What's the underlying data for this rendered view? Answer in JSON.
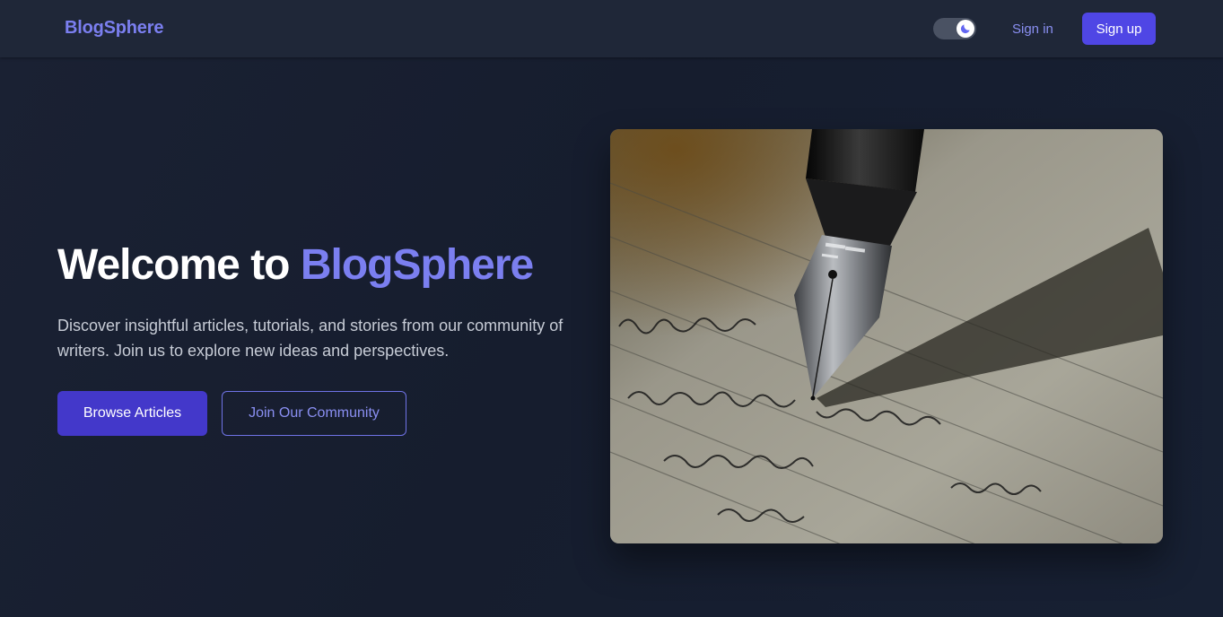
{
  "header": {
    "brand": "BlogSphere",
    "sign_in_label": "Sign in",
    "sign_up_label": "Sign up",
    "theme_toggle_icon": "moon-icon"
  },
  "hero": {
    "title_prefix": "Welcome to ",
    "title_highlight": "BlogSphere",
    "description": "Discover insightful articles, tutorials, and stories from our community of writers. Join us to explore new ideas and perspectives.",
    "primary_button": "Browse Articles",
    "secondary_button": "Join Our Community",
    "image_subject": "fountain-pen-writing-photo"
  },
  "colors": {
    "accent": "#7b7ff0",
    "primary_button": "#4338ca",
    "sign_up_button": "#4f46e5",
    "background": "#161d2e",
    "navbar": "#1f2738"
  }
}
